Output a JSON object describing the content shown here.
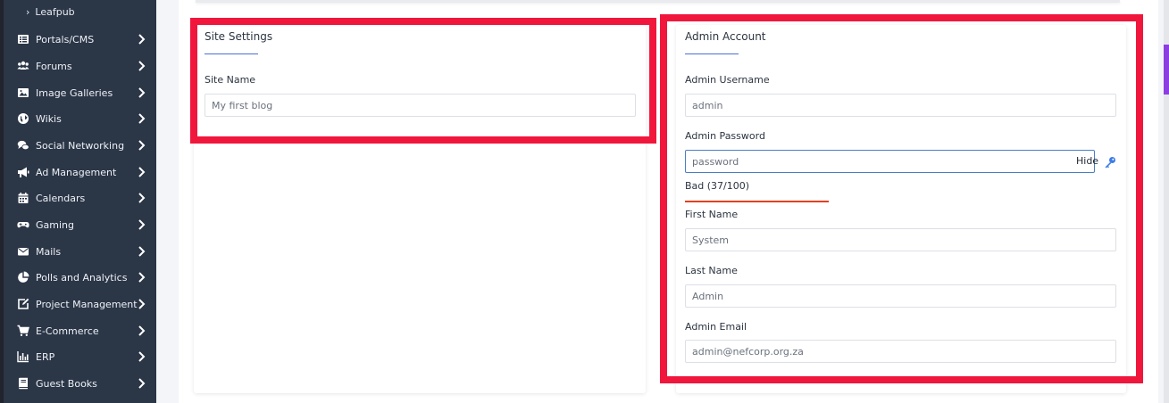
{
  "sidebar": {
    "sub_item": "Leafpub",
    "items": [
      {
        "label": "Portals/CMS",
        "icon": "list-icon"
      },
      {
        "label": "Forums",
        "icon": "users-icon"
      },
      {
        "label": "Image Galleries",
        "icon": "image-icon"
      },
      {
        "label": "Wikis",
        "icon": "globe-icon"
      },
      {
        "label": "Social Networking",
        "icon": "comments-icon"
      },
      {
        "label": "Ad Management",
        "icon": "bullhorn-icon"
      },
      {
        "label": "Calendars",
        "icon": "calendar-icon"
      },
      {
        "label": "Gaming",
        "icon": "gamepad-icon"
      },
      {
        "label": "Mails",
        "icon": "envelope-icon"
      },
      {
        "label": "Polls and Analytics",
        "icon": "pie-chart-icon"
      },
      {
        "label": "Project Management",
        "icon": "edit-icon"
      },
      {
        "label": "E-Commerce",
        "icon": "cart-icon"
      },
      {
        "label": "ERP",
        "icon": "bar-chart-icon"
      },
      {
        "label": "Guest Books",
        "icon": "book-icon"
      }
    ]
  },
  "site_settings": {
    "title": "Site Settings",
    "site_name_label": "Site Name",
    "site_name_value": "My first blog"
  },
  "admin_account": {
    "title": "Admin Account",
    "username_label": "Admin Username",
    "username_value": "admin",
    "password_label": "Admin Password",
    "password_value": "password",
    "hide_label": "Hide",
    "strength_text": "Bad (37/100)",
    "first_name_label": "First Name",
    "first_name_value": "System",
    "last_name_label": "Last Name",
    "last_name_value": "Admin",
    "email_label": "Admin Email",
    "email_value": "admin@nefcorp.org.za"
  },
  "colors": {
    "highlight": "#f0163c",
    "accent": "#4a6edc",
    "strength_bad": "#e2401f",
    "sidebar_bg": "#2b3647"
  }
}
